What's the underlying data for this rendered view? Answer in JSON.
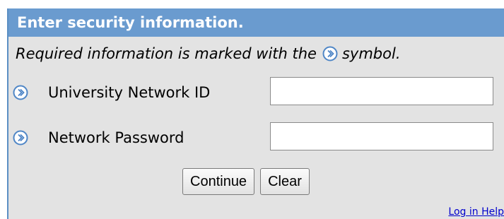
{
  "form": {
    "title": "Enter security information.",
    "required_note_before": "Required information is marked with the",
    "required_note_after": "symbol.",
    "required_icon": "chevron-circle-right-icon",
    "fields": [
      {
        "label": "University Network ID",
        "value": "",
        "placeholder": ""
      },
      {
        "label": "Network Password",
        "value": "",
        "placeholder": ""
      }
    ],
    "continue_label": "Continue",
    "clear_label": "Clear",
    "help_link": "Log in Help"
  },
  "colors": {
    "header_bg": "#6a9bcf",
    "panel_bg": "#e3e3e3",
    "icon_blue": "#4f86c6",
    "link": "#0000cc"
  }
}
